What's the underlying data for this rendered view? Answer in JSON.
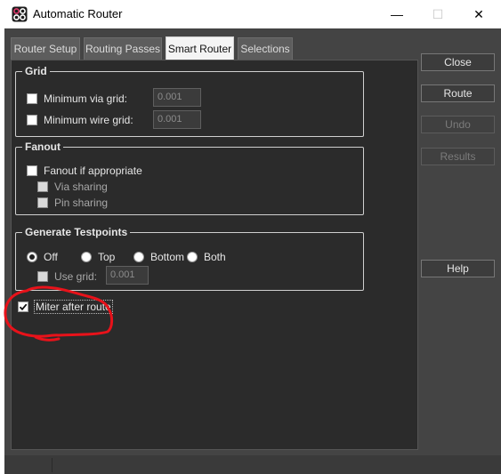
{
  "window": {
    "title": "Automatic Router",
    "minimize_glyph": "—",
    "maximize_glyph": "☐",
    "close_glyph": "✕"
  },
  "tabs": [
    {
      "label": "Router Setup",
      "active": false
    },
    {
      "label": "Routing Passes",
      "active": false
    },
    {
      "label": "Smart Router",
      "active": true
    },
    {
      "label": "Selections",
      "active": false
    }
  ],
  "grid": {
    "title": "Grid",
    "min_via_label": "Minimum via grid:",
    "min_via_value": "0.001",
    "min_wire_label": "Minimum wire grid:",
    "min_wire_value": "0.001"
  },
  "fanout": {
    "title": "Fanout",
    "fanout_label": "Fanout if appropriate",
    "via_sharing_label": "Via sharing",
    "pin_sharing_label": "Pin sharing"
  },
  "testpoints": {
    "title": "Generate Testpoints",
    "options": [
      "Off",
      "Top",
      "Bottom",
      "Both"
    ],
    "selected": "Off",
    "use_grid_label": "Use grid:",
    "use_grid_value": "0.001"
  },
  "miter": {
    "label": "Miter after route",
    "checked": true
  },
  "side_buttons": {
    "close": "Close",
    "route": "Route",
    "undo": "Undo",
    "results": "Results",
    "help": "Help"
  },
  "colors": {
    "annotation_red": "#e8121a",
    "dialog_bg": "#444444",
    "page_bg": "#2b2b2b"
  }
}
